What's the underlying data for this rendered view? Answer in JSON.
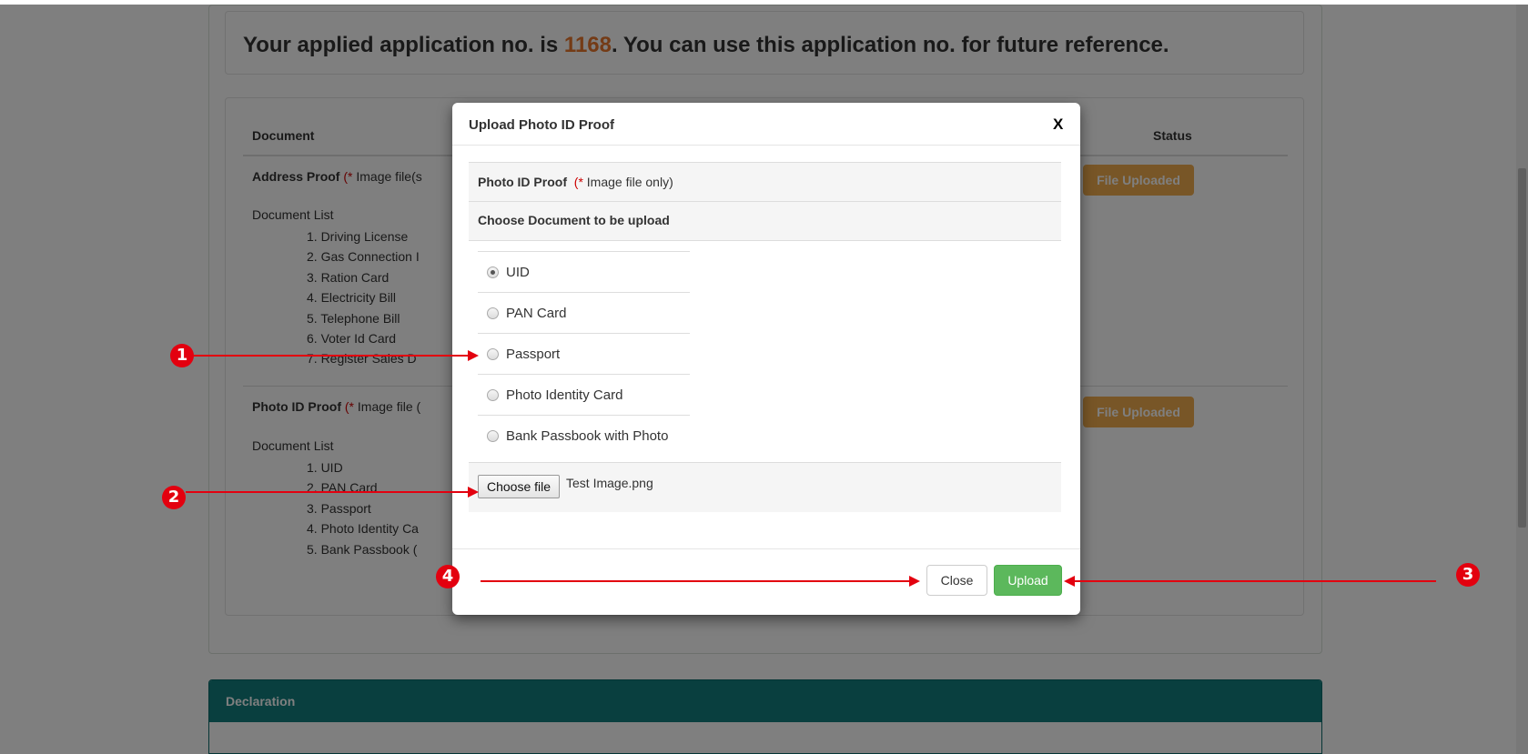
{
  "page": {
    "application_text_before": "Your applied application no. is ",
    "application_number": "1168",
    "application_text_after": ". You can use this application no. for future reference."
  },
  "documents_table": {
    "col_document": "Document",
    "col_status": "Status",
    "address_section": {
      "title": "Address Proof",
      "note_star": "(*",
      "note": " Image file(s",
      "list_label": "Document List",
      "items": [
        "1.  Driving License",
        "2.  Gas Connection I",
        "3.  Ration Card",
        "4.  Electricity Bill",
        "5.  Telephone Bill",
        "6.  Voter Id Card",
        "7.  Register Sales D"
      ],
      "status": "File Uploaded"
    },
    "photo_section": {
      "title": "Photo ID Proof",
      "note_star": "(*",
      "note": " Image file (",
      "list_label": "Document List",
      "items": [
        "1.  UID",
        "2.  PAN Card",
        "3.  Passport",
        "4.  Photo Identity Ca",
        "5.  Bank Passbook ("
      ],
      "status": "File Uploaded"
    }
  },
  "declaration": {
    "title": "Declaration"
  },
  "modal": {
    "title": "Upload Photo ID Proof",
    "close_x": "X",
    "proof_label": "Photo ID Proof",
    "proof_note_star": "(*",
    "proof_note": " Image file only)",
    "choose_heading": "Choose Document to be upload",
    "options": [
      {
        "label": "UID",
        "checked": true
      },
      {
        "label": "PAN Card",
        "checked": false
      },
      {
        "label": "Passport",
        "checked": false
      },
      {
        "label": "Photo Identity Card",
        "checked": false
      },
      {
        "label": "Bank Passbook with Photo",
        "checked": false
      }
    ],
    "choose_file_label": "Choose file",
    "selected_file": "Test Image.png",
    "close_button": "Close",
    "upload_button": "Upload"
  },
  "annotations": {
    "marker_1": "1",
    "marker_2": "2",
    "marker_3": "3",
    "marker_4": "4"
  },
  "colors": {
    "annotation_red": "#e3000f",
    "upload_green": "#5cb85c",
    "status_orange": "#f0ad4e",
    "declaration_teal": "#127f7f",
    "app_number_orange": "#e8772c"
  }
}
